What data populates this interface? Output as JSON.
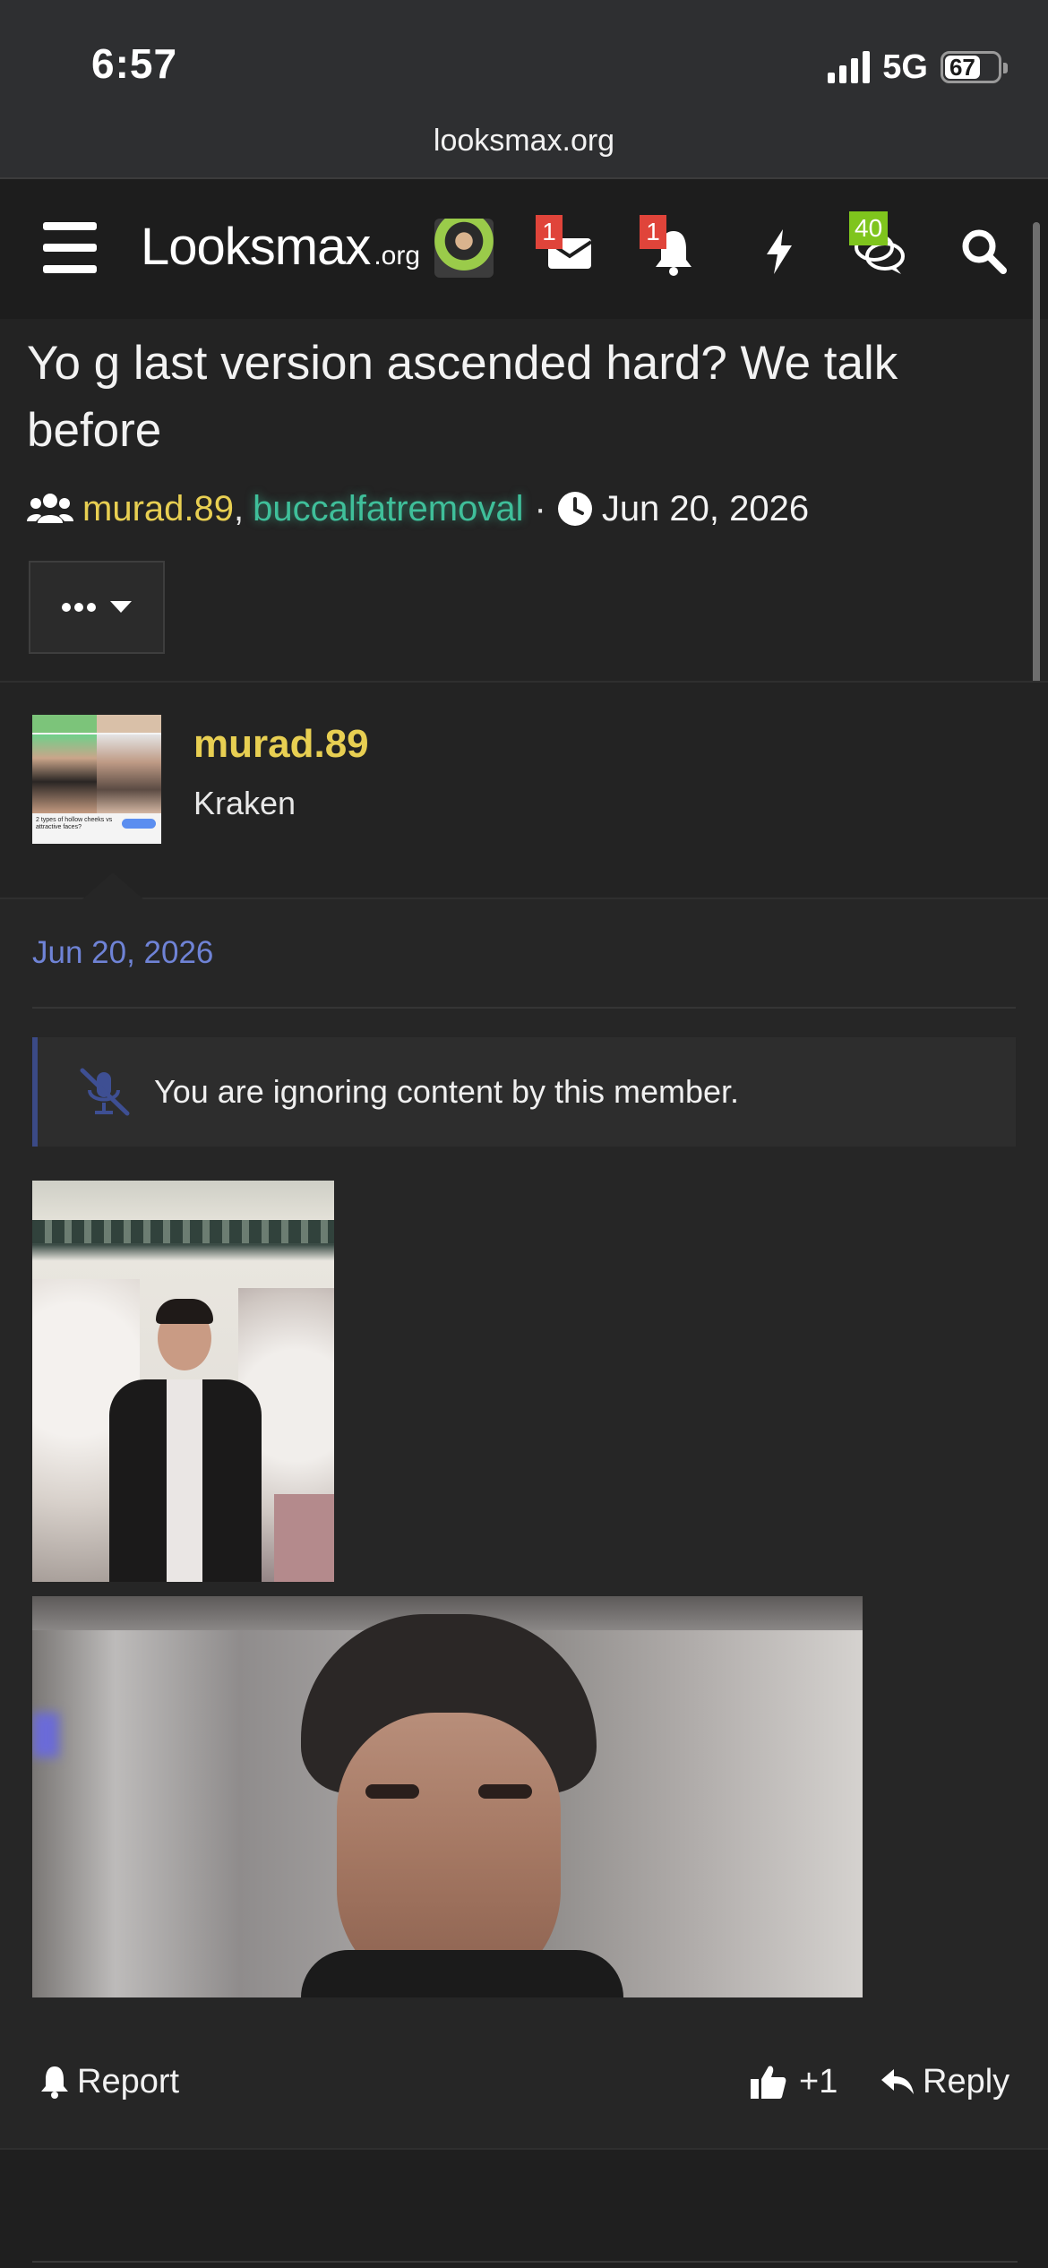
{
  "status_bar": {
    "time": "6:57",
    "network": "5G",
    "battery": "67",
    "battery_level": 0.67
  },
  "browser": {
    "url": "looksmax.org"
  },
  "navbar": {
    "logo_text": "Looksmax",
    "logo_tld": ".org",
    "conversations_badge": "1",
    "alerts_badge": "1",
    "new_posts_badge": "40",
    "icons": [
      "menu-icon",
      "avatar",
      "envelope-icon",
      "bell-icon",
      "bolt-icon",
      "chat-bubbles-icon",
      "search-icon"
    ]
  },
  "thread": {
    "title": "Yo g last version ascended hard? We talk before",
    "participant_1": "murad.89",
    "participant_sep": ",",
    "participant_2": "buccalfatremoval",
    "meta_dot": "·",
    "date": "Jun 20, 2026"
  },
  "post": {
    "author": "murad.89",
    "author_title": "Kraken",
    "avatar_caption": "2 types of hollow cheeks vs attractive faces?",
    "date": "Jun 20, 2026",
    "ignored_notice": "You are ignoring content by this member.",
    "report_label": "Report",
    "like_label": "+1",
    "reply_label": "Reply"
  },
  "colors": {
    "page_bg": "#232323",
    "status_bg": "#2e2f31",
    "navbar_bg": "#1d1d1d",
    "author_yellow": "#e8cf52",
    "author_teal": "#3fbf9a",
    "date_blue": "#6f83d6",
    "badge_red": "#e0443a",
    "badge_green": "#7fc51d"
  }
}
